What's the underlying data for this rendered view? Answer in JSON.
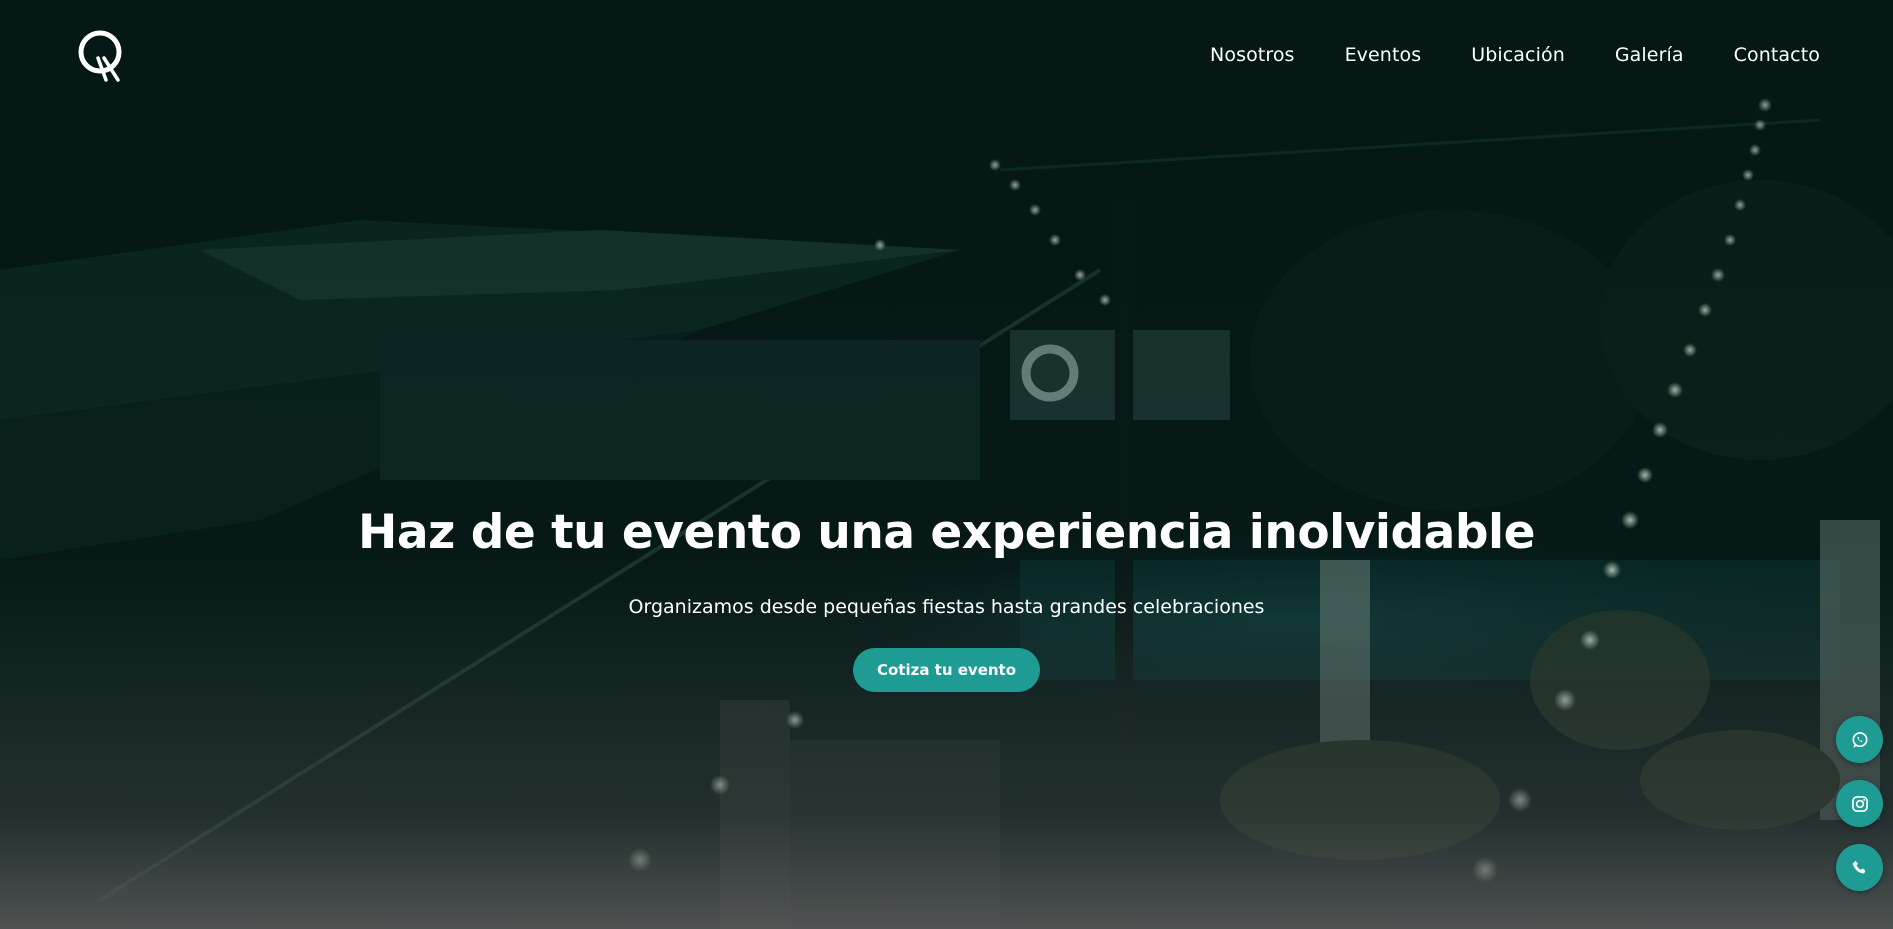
{
  "brand": {
    "logo_icon": "q-logo-icon",
    "accent": "#1e9c94"
  },
  "nav": {
    "items": [
      {
        "label": "Nosotros"
      },
      {
        "label": "Eventos"
      },
      {
        "label": "Ubicación"
      },
      {
        "label": "Galería"
      },
      {
        "label": "Contacto"
      }
    ]
  },
  "hero": {
    "title": "Haz de tu evento una experiencia inolvidable",
    "subtitle": "Organizamos desde pequeñas fiestas hasta grandes celebraciones",
    "cta_label": "Cotiza tu evento"
  },
  "floating_actions": [
    {
      "icon": "whatsapp-icon"
    },
    {
      "icon": "instagram-icon"
    },
    {
      "icon": "phone-icon"
    }
  ]
}
